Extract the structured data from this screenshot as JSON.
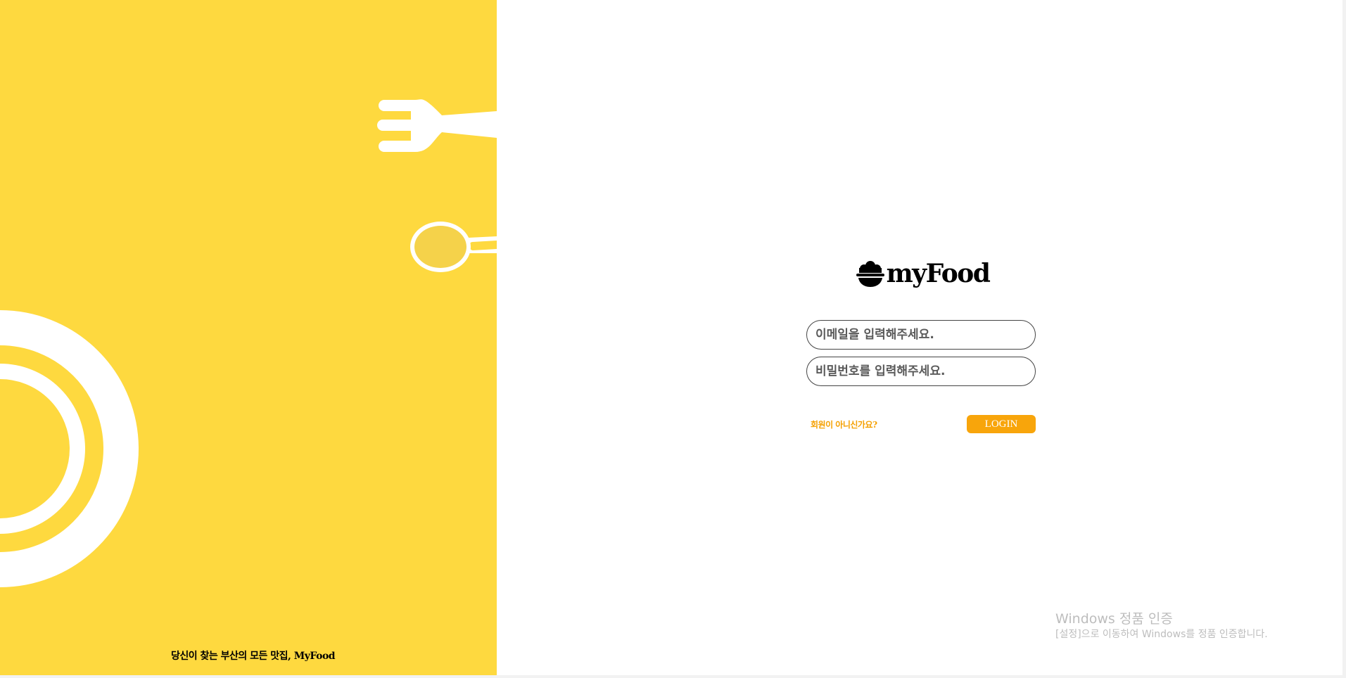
{
  "brand": {
    "name": "myFood",
    "tagline": "당신이 찾는 부산의 모든 맛집, MyFood",
    "icon": "rice-bowl-icon"
  },
  "login_form": {
    "email_placeholder": "이메일을 입력해주세요.",
    "password_placeholder": "비밀번호를 입력해주세요.",
    "signup_link": "회원이 아니신가요?",
    "login_button": "LOGIN"
  },
  "decorations": {
    "fork": "fork-icon",
    "spoon": "spoon-icon",
    "plate": "plate-icon"
  },
  "windows_watermark": {
    "title": "Windows 정품 인증",
    "description": "[설정]으로 이동하여 Windows를 정품 인증합니다."
  },
  "colors": {
    "panel_yellow": "#fed93f",
    "accent_orange": "#f8a50b",
    "link_orange": "#f5a000",
    "spoon_fill": "#f5d24a"
  }
}
